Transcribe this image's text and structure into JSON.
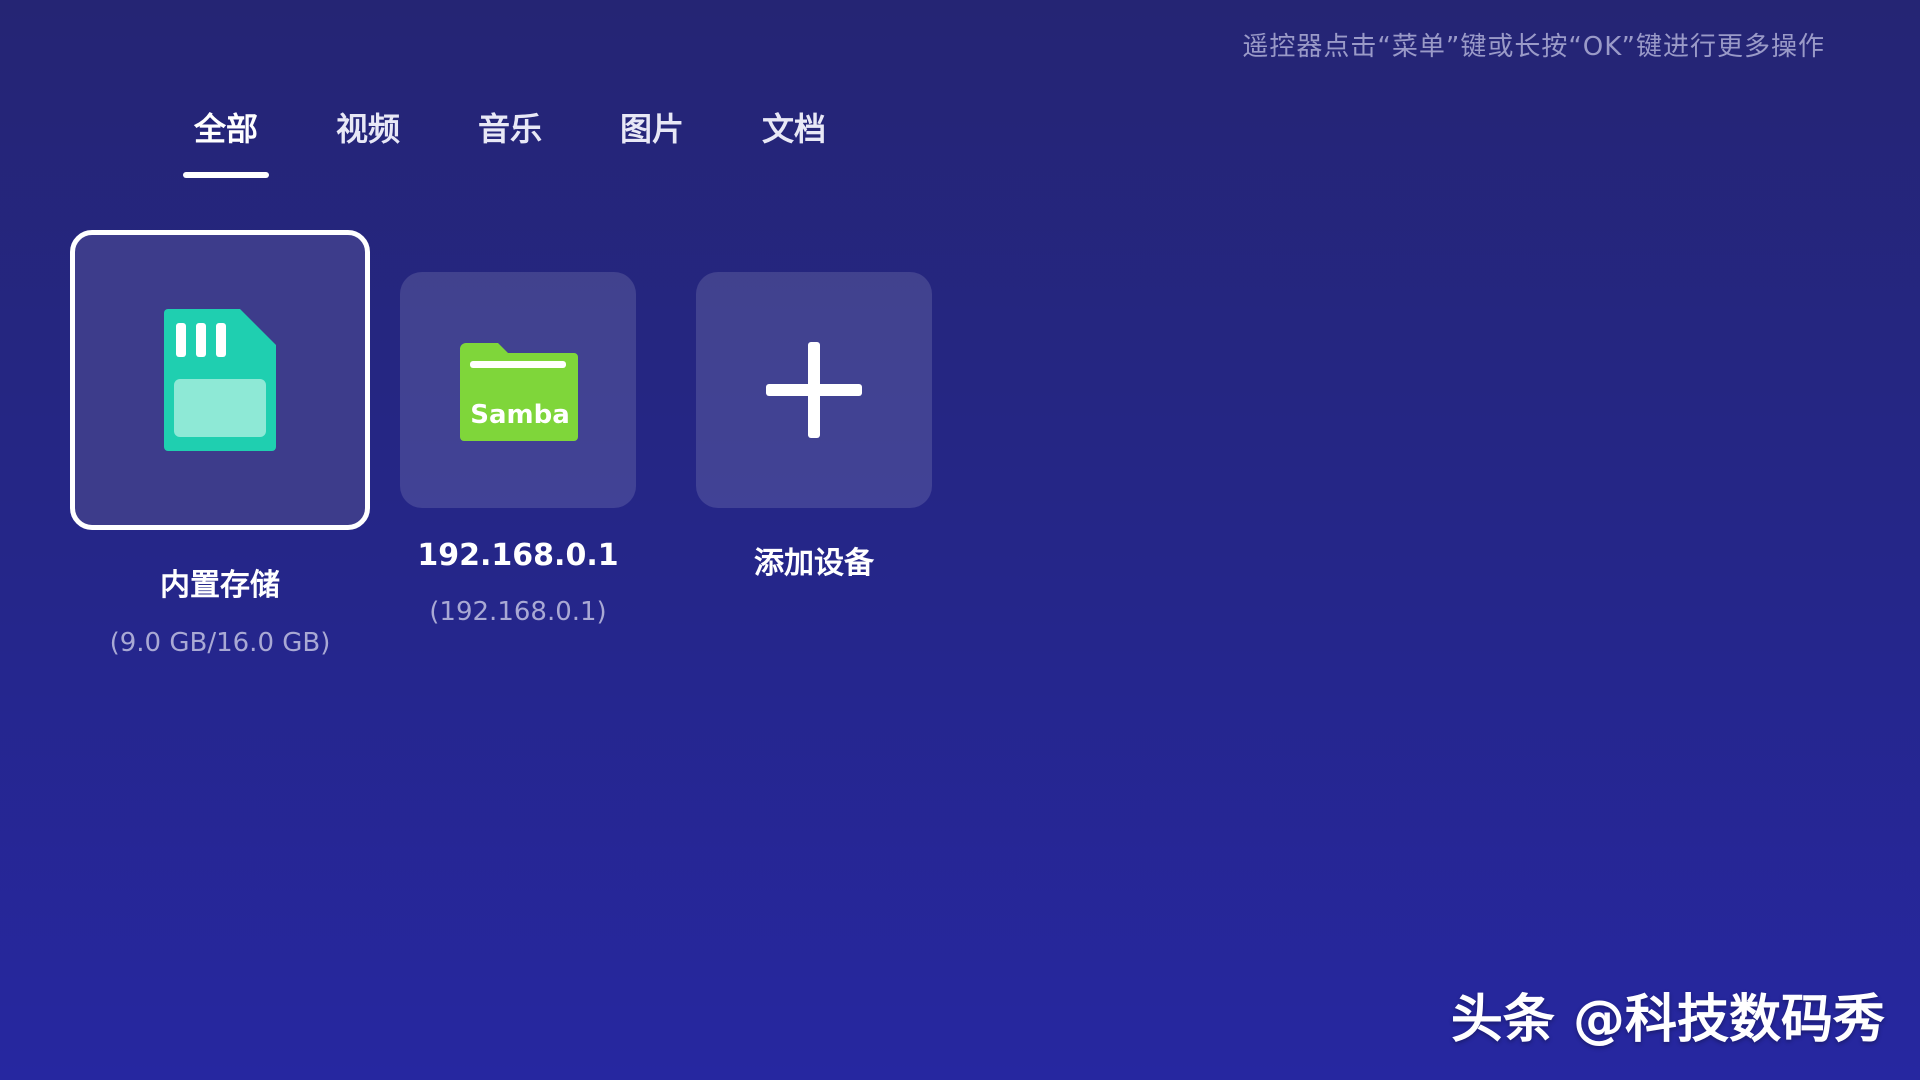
{
  "header": {
    "hint": "遥控器点击“菜单”键或长按“OK”键进行更多操作"
  },
  "tabs": [
    {
      "label": "全部",
      "active": true
    },
    {
      "label": "视频",
      "active": false
    },
    {
      "label": "音乐",
      "active": false
    },
    {
      "label": "图片",
      "active": false
    },
    {
      "label": "文档",
      "active": false
    }
  ],
  "devices": [
    {
      "title": "内置存储",
      "subtitle": "(9.0 GB/16.0 GB)",
      "icon": "sd-card-icon",
      "focused": true
    },
    {
      "title": "192.168.0.1",
      "subtitle": "(192.168.0.1)",
      "icon": "samba-folder-icon",
      "icon_label": "Samba",
      "focused": false
    },
    {
      "title": "添加设备",
      "icon": "plus-icon",
      "focused": false
    }
  ],
  "watermark": "头条 @科技数码秀",
  "colors": {
    "background": "#25268a",
    "sd_card": "#1fcfb0",
    "samba_folder": "#7fd63a"
  }
}
